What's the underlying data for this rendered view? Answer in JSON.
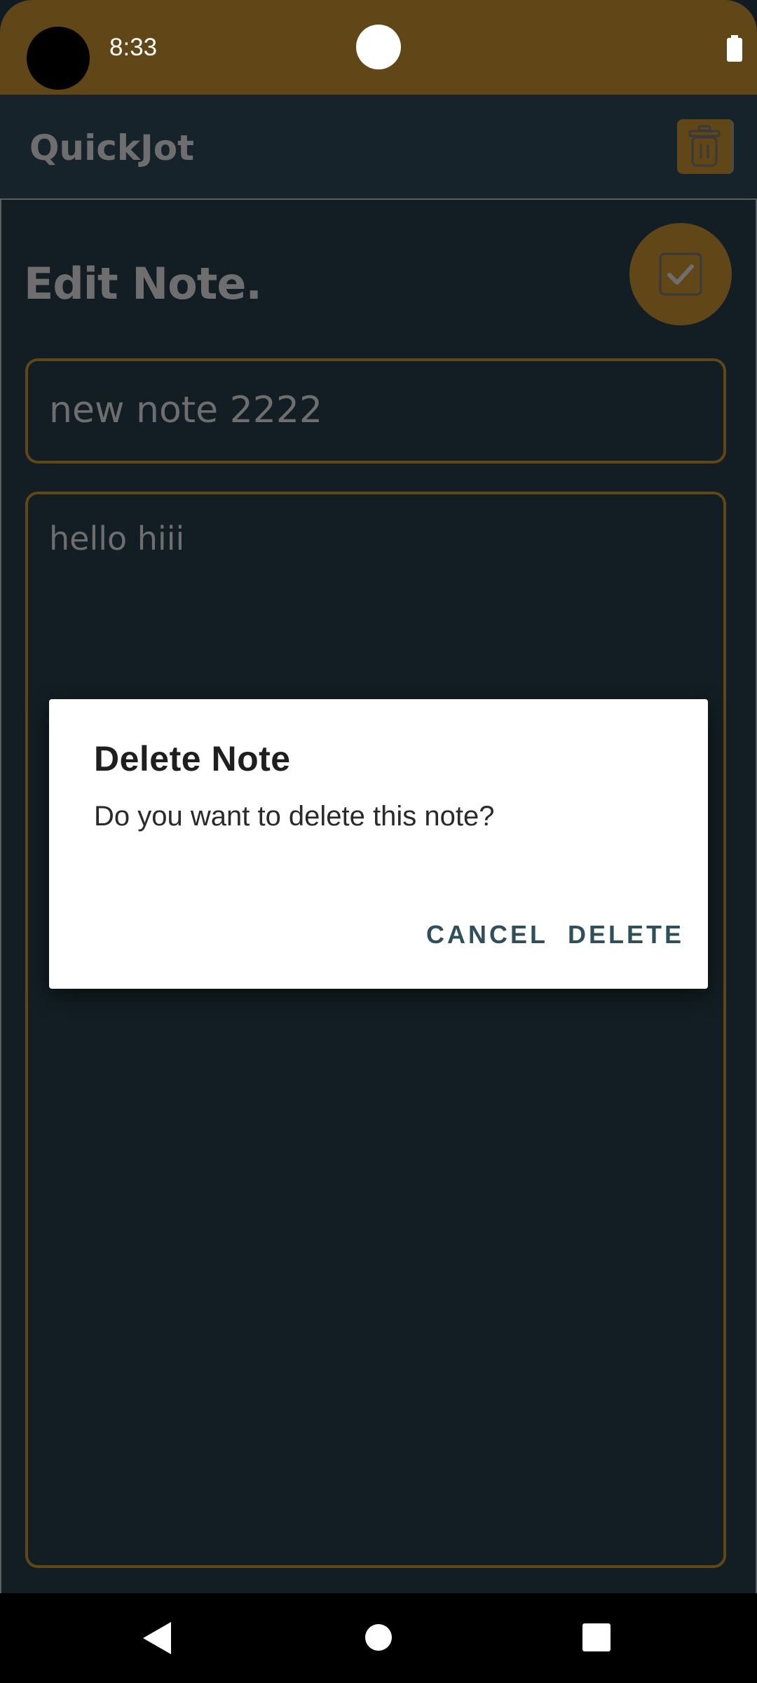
{
  "status_bar": {
    "time": "8:33",
    "battery_icon": "battery-full-icon",
    "color": "#614617"
  },
  "app_bar": {
    "title": "QuickJot",
    "delete_icon": "trash-icon"
  },
  "editor": {
    "heading": "Edit Note.",
    "save_icon": "checkbox-check-icon",
    "title_value": "new note 2222",
    "body_value": "hello hiii"
  },
  "dialog": {
    "title": "Delete Note",
    "message": "Do you want to delete this note?",
    "cancel_label": "CANCEL",
    "delete_label": "DELETE"
  },
  "nav_bar": {
    "back_icon": "back-triangle-icon",
    "home_icon": "home-circle-icon",
    "recents_icon": "recents-square-icon"
  },
  "colors": {
    "accent": "#614617",
    "background": "#121e23",
    "muted_text": "#6e6e6e",
    "dialog_button": "#2f4f5c"
  }
}
